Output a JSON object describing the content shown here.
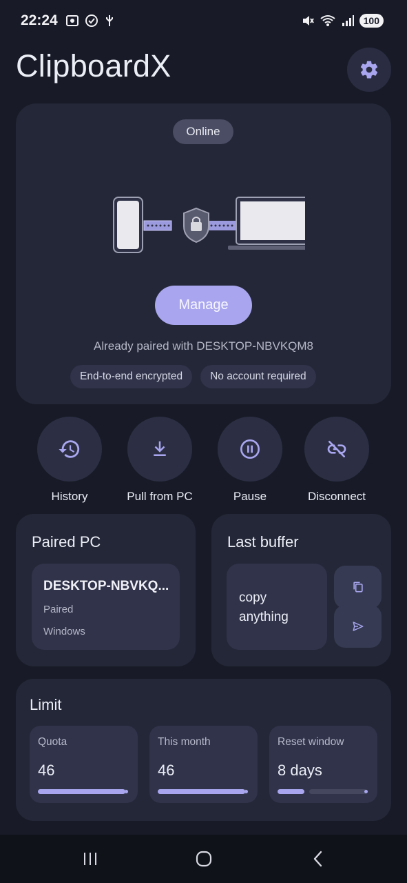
{
  "status": {
    "time": "22:24",
    "battery": "100",
    "left_icons": [
      "screenshot-icon",
      "check-icon",
      "usb-icon"
    ],
    "right_icons": [
      "mute-icon",
      "wifi-icon",
      "signal-icon"
    ]
  },
  "app": {
    "title": "ClipboardX"
  },
  "hero": {
    "status_pill": "Online",
    "manage_label": "Manage",
    "paired_with": "Already paired with DESKTOP-NBVKQM8",
    "chips": [
      "End-to-end encrypted",
      "No account required"
    ]
  },
  "actions": [
    {
      "label": "History",
      "icon": "history-icon"
    },
    {
      "label": "Pull from PC",
      "icon": "download-icon"
    },
    {
      "label": "Pause",
      "icon": "pause-icon"
    },
    {
      "label": "Disconnect",
      "icon": "link-off-icon"
    }
  ],
  "paired_pc": {
    "title": "Paired PC",
    "name": "DESKTOP-NBVKQ...",
    "status": "Paired",
    "os": "Windows"
  },
  "last_buffer": {
    "title": "Last buffer",
    "text_line1": "copy",
    "text_line2": "anything"
  },
  "limit": {
    "title": "Limit",
    "items": [
      {
        "label": "Quota",
        "value": "46",
        "progress": 0.97
      },
      {
        "label": "This month",
        "value": "46",
        "progress": 0.97
      },
      {
        "label": "Reset window",
        "value": "8 days",
        "progress": 0.3
      }
    ]
  },
  "colors": {
    "accent": "#a9a6ef",
    "background": "#181b27",
    "card": "#242737"
  }
}
